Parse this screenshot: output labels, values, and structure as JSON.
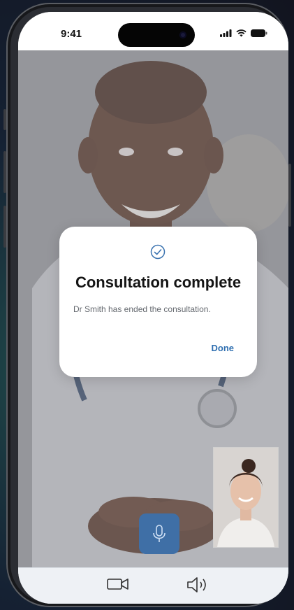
{
  "status_bar": {
    "time": "9:41",
    "icons": [
      "cellular-signal-icon",
      "wifi-icon",
      "battery-icon"
    ]
  },
  "call": {
    "remote_participant_video": "doctor-video",
    "self_view_video": "self-view",
    "mic_icon": "microphone-icon"
  },
  "toolbar": {
    "icons": [
      "video-camera-icon",
      "speaker-icon"
    ]
  },
  "modal": {
    "icon": "check-circle-icon",
    "title": "Consultation complete",
    "message": "Dr Smith has ended the consultation.",
    "done_label": "Done"
  },
  "colors": {
    "accent": "#2f6fb0",
    "mic_button": "#3f6fa6",
    "toolbar_bg": "#eef1f5"
  }
}
